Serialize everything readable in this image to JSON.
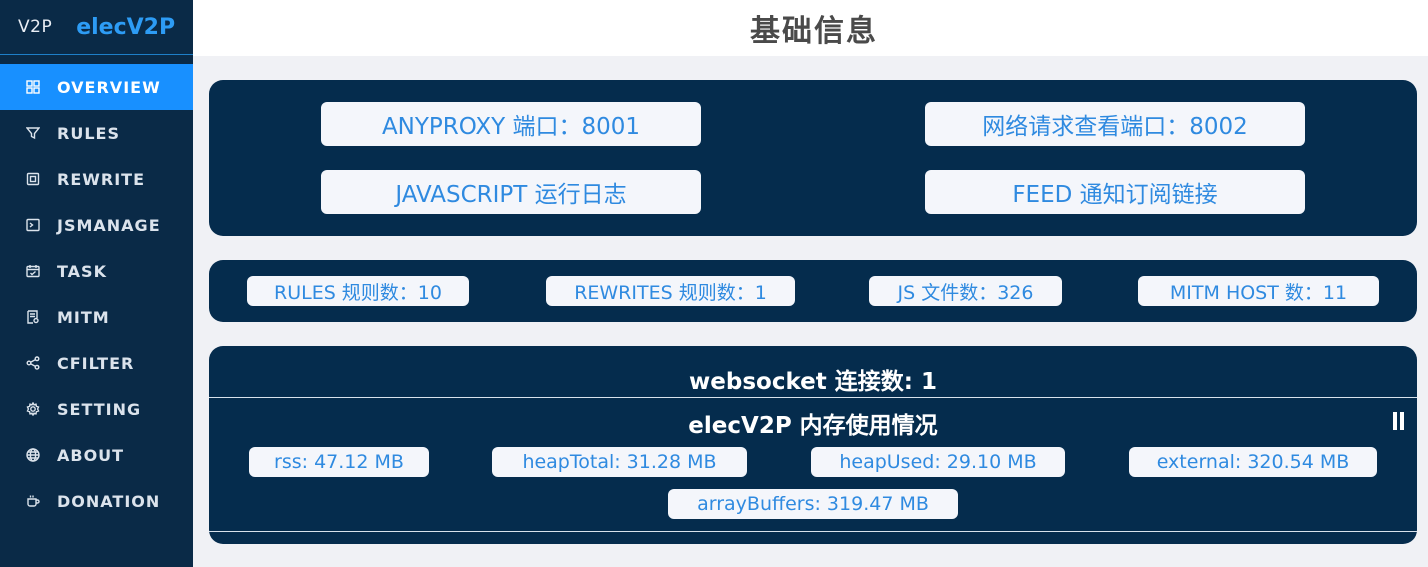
{
  "sidebar": {
    "logo": "V2P",
    "app_name": "elecV2P",
    "items": [
      {
        "label": "OVERVIEW",
        "icon": "grid-icon"
      },
      {
        "label": "RULES",
        "icon": "filter-icon"
      },
      {
        "label": "REWRITE",
        "icon": "rewrite-icon"
      },
      {
        "label": "JSMANAGE",
        "icon": "terminal-icon"
      },
      {
        "label": "TASK",
        "icon": "calendar-icon"
      },
      {
        "label": "MITM",
        "icon": "certificate-icon"
      },
      {
        "label": "CFILTER",
        "icon": "share-icon"
      },
      {
        "label": "SETTING",
        "icon": "gear-icon"
      },
      {
        "label": "ABOUT",
        "icon": "globe-icon"
      },
      {
        "label": "DONATION",
        "icon": "coffee-icon"
      }
    ],
    "active_index": 0
  },
  "header": {
    "title": "基础信息"
  },
  "links": {
    "anyproxy": "ANYPROXY 端口：8001",
    "netview": "网络请求查看端口：8002",
    "jslog": "JAVASCRIPT 运行日志",
    "feed": "FEED 通知订阅链接"
  },
  "stats": {
    "rules": "RULES 规则数：10",
    "rewrites": "REWRITES 规则数：1",
    "js": "JS 文件数：326",
    "mitm": "MITM HOST 数：11"
  },
  "websocket": {
    "title": "websocket 连接数: 1"
  },
  "memory": {
    "title": "elecV2P 内存使用情况",
    "rss": "rss: 47.12 MB",
    "heapTotal": "heapTotal: 31.28 MB",
    "heapUsed": "heapUsed: 29.10 MB",
    "external": "external: 320.54 MB",
    "arrayBuffers": "arrayBuffers: 319.47 MB"
  },
  "colors": {
    "sidebar_bg": "#0a2a47",
    "active_bg": "#1890ff",
    "panel_bg": "#052c4d",
    "pill_text": "#2f8ae0",
    "brand_text": "#2d9cf5"
  }
}
